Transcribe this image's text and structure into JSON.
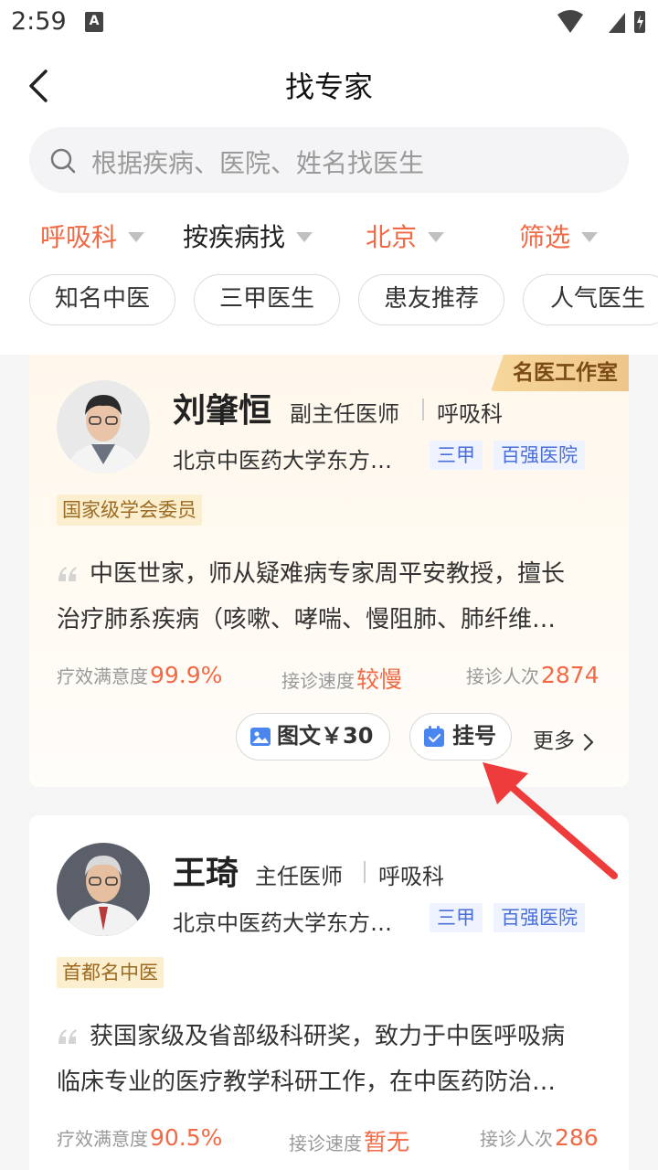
{
  "status_bar": {
    "time": "2:59",
    "a_badge": "A"
  },
  "nav": {
    "title": "找专家"
  },
  "search": {
    "placeholder": "根据疾病、医院、姓名找医生"
  },
  "filters": [
    {
      "label": "呼吸科",
      "active": true
    },
    {
      "label": "按疾病找",
      "active": false
    },
    {
      "label": "北京",
      "active": true
    },
    {
      "label": "筛选",
      "active": true
    }
  ],
  "chips": [
    "知名中医",
    "三甲医生",
    "患友推荐",
    "人气医生"
  ],
  "doctors": [
    {
      "studio_badge": "名医工作室",
      "name": "刘肇恒",
      "title": "副主任医师",
      "dept": "呼吸科",
      "hospital": "北京中医药大学东方…",
      "tags": [
        "三甲",
        "百强医院"
      ],
      "honor": "国家级学会委员",
      "intro_line1": "中医世家，师从疑难病专家周平安教授，擅长",
      "intro_line2": "治疗肺系疾病（咳嗽、哮喘、慢阻肺、肺纤维…",
      "stats": [
        {
          "label": "疗效满意度",
          "value": "99.9%"
        },
        {
          "label": "接诊速度",
          "value": "较慢"
        },
        {
          "label": "接诊人次",
          "value": "2874"
        }
      ],
      "btn_consult": "图文￥30",
      "btn_register": "挂号",
      "more": "更多"
    },
    {
      "name": "王琦",
      "title": "主任医师",
      "dept": "呼吸科",
      "hospital": "北京中医药大学东方…",
      "tags": [
        "三甲",
        "百强医院"
      ],
      "honor": "首都名中医",
      "intro_line1": "获国家级及省部级科研奖，致力于中医呼吸病",
      "intro_line2": "临床专业的医疗教学科研工作，在中医药防治…",
      "stats": [
        {
          "label": "疗效满意度",
          "value": "90.5%"
        },
        {
          "label": "接诊速度",
          "value": "暂无"
        },
        {
          "label": "接诊人次",
          "value": "286"
        }
      ]
    }
  ],
  "colors": {
    "accent": "#f26a45",
    "annotation_arrow": "#ee3b3b",
    "tag_blue": "#4a6fd8"
  }
}
